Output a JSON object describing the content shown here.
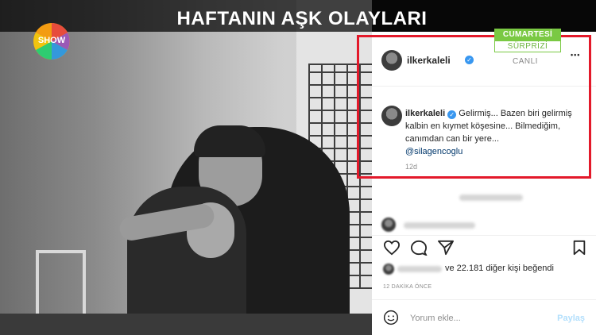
{
  "banner": {
    "title": "HAFTANIN AŞK OLAYLARI"
  },
  "channel": {
    "logo_text": "SHOW"
  },
  "program_badge": {
    "line1": "CUMARTESİ",
    "line2": "SÜRPRİZİ",
    "live": "CANLI"
  },
  "post": {
    "username": "ilkerkaleli",
    "more_label": "•••",
    "caption_user": "ilkerkaleli",
    "caption_text": "Gelirmiş... Bazen biri gelirmiş kalbin en kıymet köşesine... Bilmediğim, canımdan can bir yere...",
    "mention": "@silagencoglu",
    "time": "12d",
    "likes_text": "ve 22.181 diğer kişi beğendi",
    "ago": "12 DAKİKA ÖNCE",
    "comment_placeholder": "Yorum ekle...",
    "post_button": "Paylaş"
  },
  "colors": {
    "highlight": "#e3192a",
    "verified": "#3897f0",
    "badge": "#7ac943"
  }
}
